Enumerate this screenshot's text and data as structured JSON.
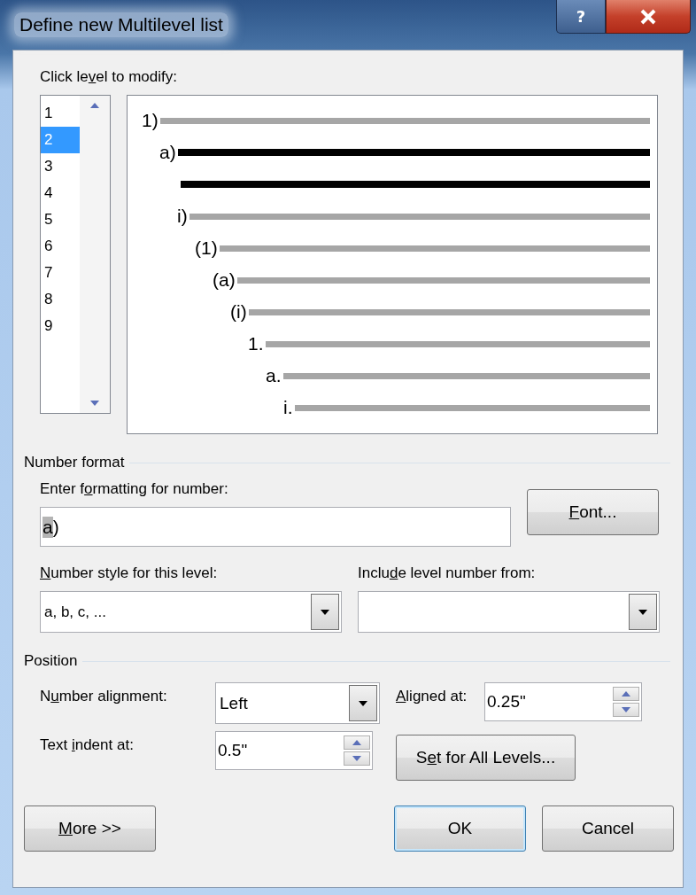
{
  "window": {
    "title": "Define new Multilevel list",
    "help_button": "?"
  },
  "level_picker": {
    "label": {
      "before": "Click le",
      "key": "v",
      "after": "el to modify:"
    },
    "levels": [
      {
        "label": "1",
        "selected": false
      },
      {
        "label": "2",
        "selected": true
      },
      {
        "label": "3",
        "selected": false
      },
      {
        "label": "4",
        "selected": false
      },
      {
        "label": "5",
        "selected": false
      },
      {
        "label": "6",
        "selected": false
      },
      {
        "label": "7",
        "selected": false
      },
      {
        "label": "8",
        "selected": false
      },
      {
        "label": "9",
        "selected": false
      }
    ]
  },
  "preview": {
    "rows": [
      {
        "number": "1)",
        "selected": false
      },
      {
        "number": "a)",
        "selected": true
      },
      {
        "number": "i)",
        "selected": false
      },
      {
        "number": "(1)",
        "selected": false
      },
      {
        "number": "(a)",
        "selected": false
      },
      {
        "number": "(i)",
        "selected": false
      },
      {
        "number": "1.",
        "selected": false
      },
      {
        "number": "a.",
        "selected": false
      },
      {
        "number": "i.",
        "selected": false
      }
    ]
  },
  "number_format": {
    "heading": "Number format",
    "format_label": {
      "before": "Enter f",
      "key": "o",
      "after": "rmatting for number:"
    },
    "format_value_selected": "a",
    "format_value_rest": ")",
    "font_button": {
      "key": "F",
      "after": "ont..."
    },
    "style_label": {
      "key": "N",
      "after": "umber style for this level:"
    },
    "style_value": "a, b, c, ...",
    "include_label": {
      "before": "Inclu",
      "key": "d",
      "after": "e level number from:"
    }
  },
  "position": {
    "heading": "Position",
    "alignment_label": {
      "before": "N",
      "key": "u",
      "after": "mber alignment:"
    },
    "alignment_value": "Left",
    "aligned_at_label": {
      "key": "A",
      "after": "ligned at:"
    },
    "aligned_at_value": "0.25\"",
    "indent_label": {
      "before": "Text ",
      "key": "i",
      "after": "ndent at:"
    },
    "indent_value": "0.5\"",
    "set_all_button": {
      "before": "S",
      "key": "e",
      "after": "t for All Levels..."
    }
  },
  "buttons": {
    "more": {
      "key": "M",
      "after": "ore >>"
    },
    "ok": "OK",
    "cancel": "Cancel"
  }
}
